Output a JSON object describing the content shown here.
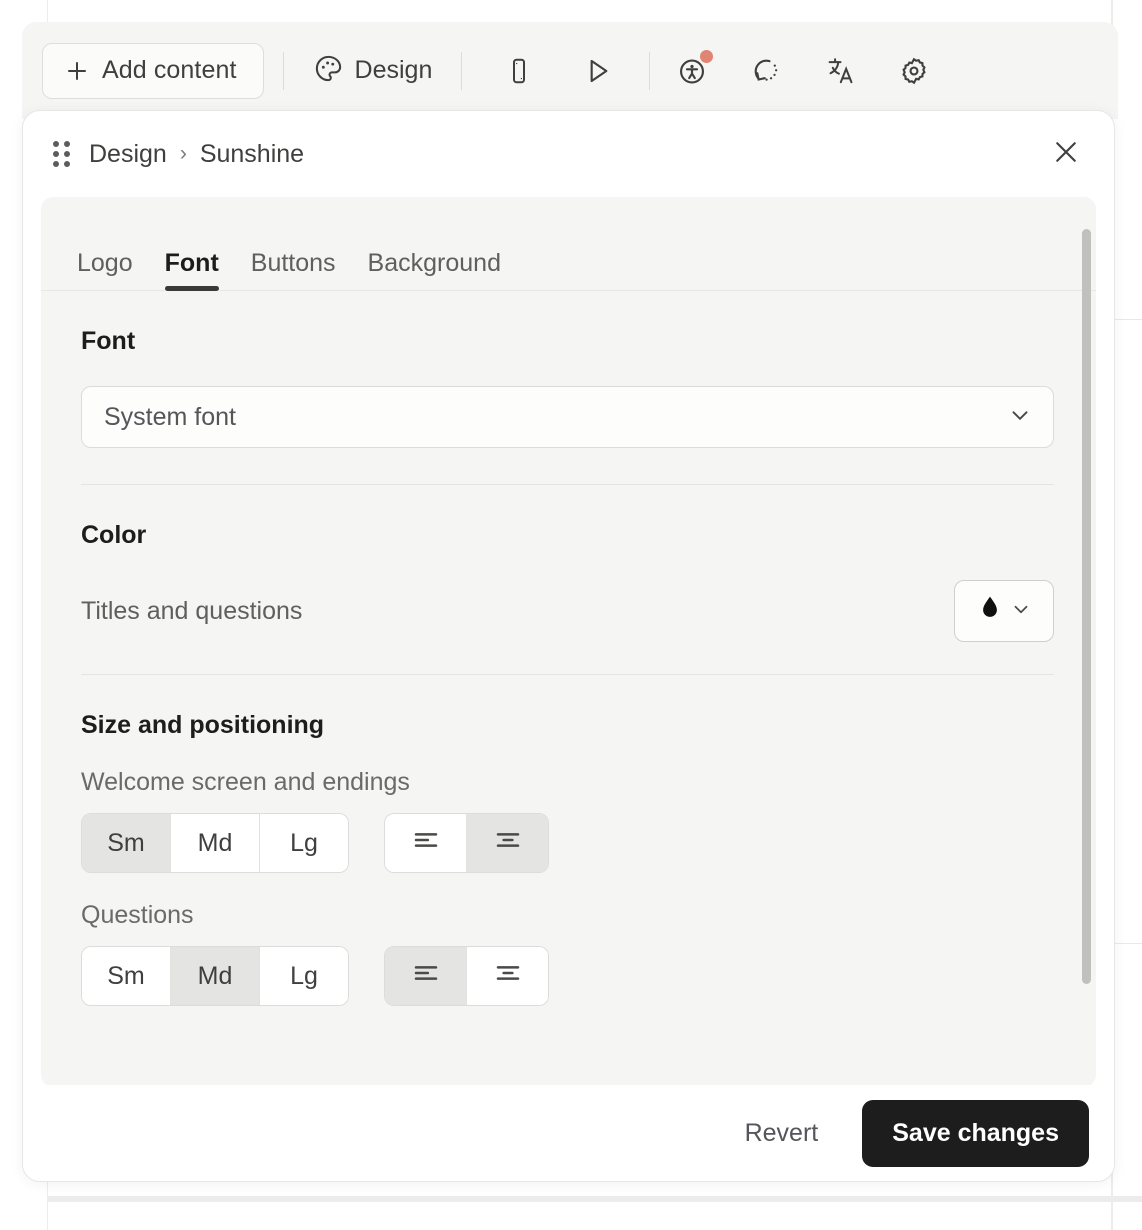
{
  "toolbar": {
    "add_content_label": "Add content",
    "design_label": "Design",
    "icons": {
      "plus": "plus-icon",
      "palette": "palette-icon",
      "mobile_preview": "mobile-preview-icon",
      "play_preview": "play-preview-icon",
      "accessibility": "accessibility-icon",
      "reset_history": "reset-history-icon",
      "translate": "translate-icon",
      "settings": "gear-icon"
    },
    "accessibility_badge_color": "#e08573"
  },
  "panel": {
    "breadcrumb": {
      "root": "Design",
      "separator": "›",
      "leaf": "Sunshine"
    },
    "close_label": "✕",
    "tabs": [
      {
        "label": "Logo",
        "active": false
      },
      {
        "label": "Font",
        "active": true
      },
      {
        "label": "Buttons",
        "active": false
      },
      {
        "label": "Background",
        "active": false
      }
    ],
    "sections": {
      "font": {
        "title": "Font",
        "select_value": "System font"
      },
      "color": {
        "title": "Color",
        "row_label": "Titles and questions",
        "swatch_color": "#101010"
      },
      "size_positioning": {
        "title": "Size and positioning",
        "groups": [
          {
            "label": "Welcome screen and endings",
            "sizes": [
              "Sm",
              "Md",
              "Lg"
            ],
            "selected_size": "Sm",
            "alignments": [
              "align-left",
              "align-center"
            ],
            "selected_alignment": "align-center"
          },
          {
            "label": "Questions",
            "sizes": [
              "Sm",
              "Md",
              "Lg"
            ],
            "selected_size": "Md",
            "alignments": [
              "align-left",
              "align-center"
            ],
            "selected_alignment": "align-left"
          }
        ]
      }
    },
    "footer": {
      "revert_label": "Revert",
      "save_label": "Save changes",
      "save_bg": "#1d1d1d"
    }
  }
}
